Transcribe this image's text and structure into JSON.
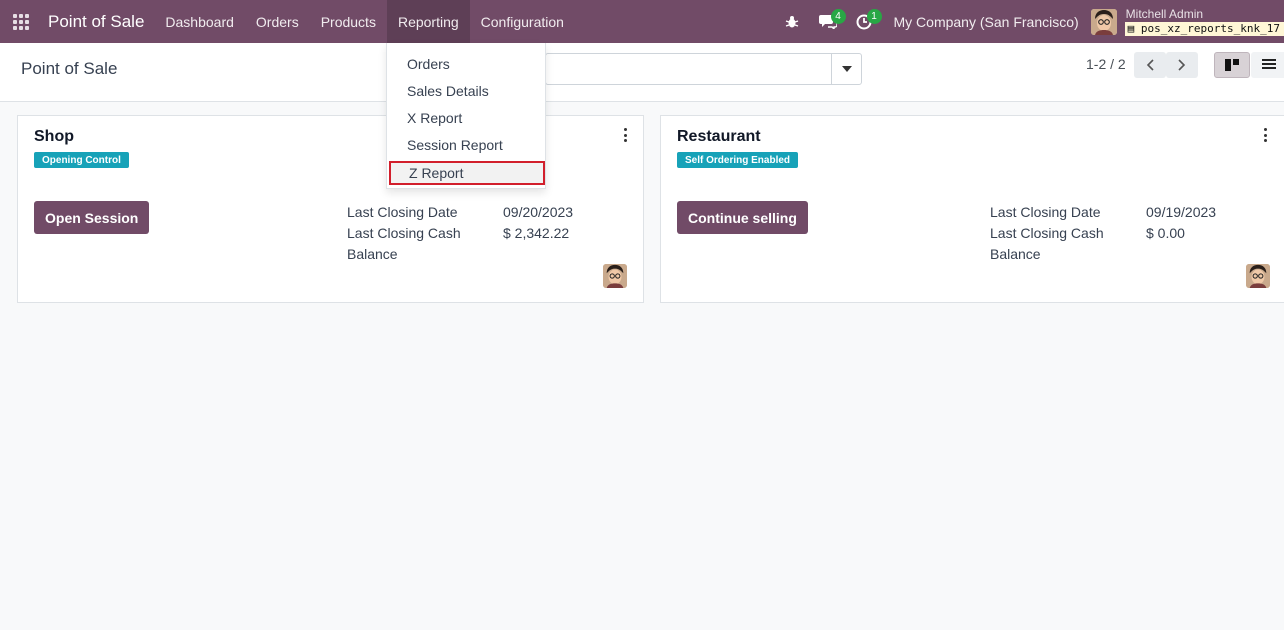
{
  "navbar": {
    "brand": "Point of Sale",
    "menu": [
      "Dashboard",
      "Orders",
      "Products",
      "Reporting",
      "Configuration"
    ],
    "messages_count": "4",
    "activities_count": "1",
    "company": "My Company (San Francisco)",
    "user_name": "Mitchell Admin",
    "db_name": "pos_xz_reports_knk_17"
  },
  "control": {
    "title": "Point of Sale",
    "pager": "1-2 / 2"
  },
  "reporting_menu": [
    "Orders",
    "Sales Details",
    "X Report",
    "Session Report",
    "Z Report"
  ],
  "cards": [
    {
      "title": "Shop",
      "badge": "Opening Control",
      "button": "Open Session",
      "closing_date_label": "Last Closing Date",
      "closing_date": "09/20/2023",
      "closing_cash_label": "Last Closing Cash",
      "closing_cash_label2": "Balance",
      "closing_cash": "$ 2,342.22"
    },
    {
      "title": "Restaurant",
      "badge": "Self Ordering Enabled",
      "button": "Continue selling",
      "closing_date_label": "Last Closing Date",
      "closing_date": "09/19/2023",
      "closing_cash_label": "Last Closing Cash",
      "closing_cash_label2": "Balance",
      "closing_cash": "$ 0.00"
    }
  ],
  "colors": {
    "brand": "#714b67",
    "badge": "#17a2b8",
    "highlight_border": "#d21f2c",
    "count_badge": "#28a745"
  }
}
